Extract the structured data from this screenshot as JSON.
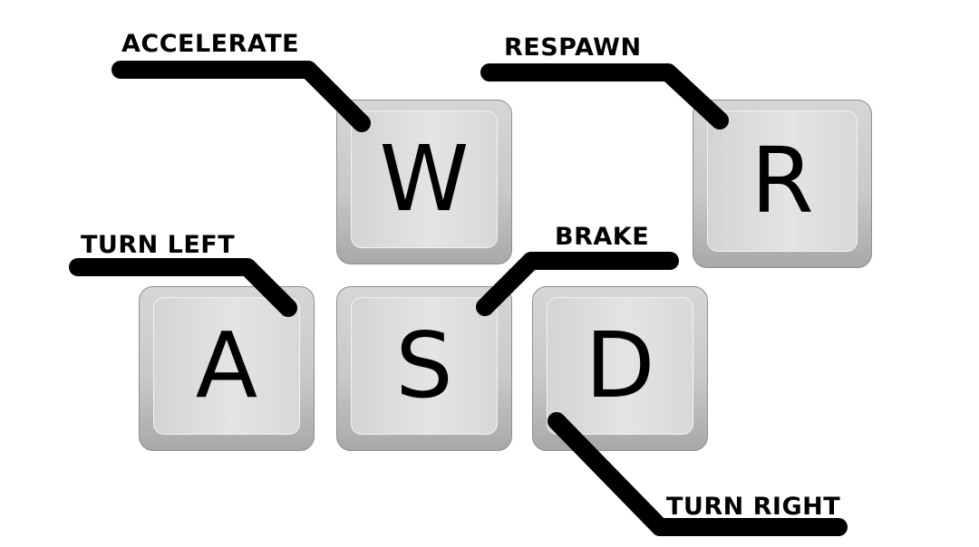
{
  "keys": {
    "w": "W",
    "r": "R",
    "a": "A",
    "s": "S",
    "d": "D"
  },
  "labels": {
    "accelerate": "ACCELERATE",
    "respawn": "RESPAWN",
    "turn_left": "TURN LEFT",
    "brake": "BRAKE",
    "turn_right": "TURN RIGHT"
  },
  "colors": {
    "background": "#ffffff",
    "key_body": "#c9c9c9",
    "key_face": "#dcdcdc",
    "text": "#000000",
    "leader": "#000000"
  }
}
